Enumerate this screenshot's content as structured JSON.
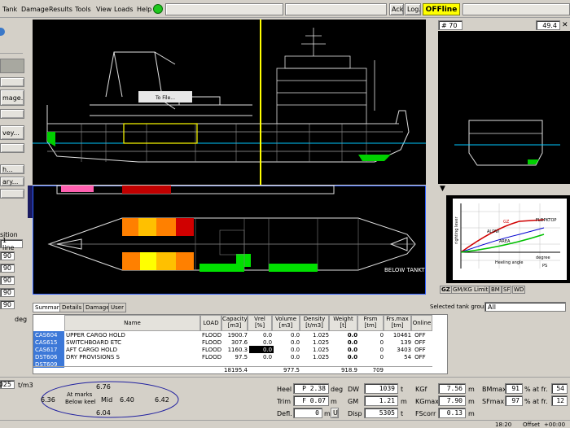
{
  "menu": {
    "tank": "Tank",
    "damage": "Damage",
    "results": "Results",
    "tools": "Tools",
    "view": "View",
    "loads": "Loads",
    "help": "Help"
  },
  "toolbar": {
    "ack": "Ack.",
    "log": "Log...",
    "status": "OFFline"
  },
  "left_buttons": {
    "damage": "mage...",
    "survey": "vey...",
    "btn1": "h...",
    "btn2": "ary...",
    "position": "sition",
    "line_select": "1 line",
    "deg": "deg",
    "v1": "90",
    "v2": "90",
    "v3": "90",
    "v4": "90",
    "v5": "90"
  },
  "profile": {
    "to_file": "To File...",
    "below_tank": "BELOW TANKT"
  },
  "section": {
    "frame": "# 70",
    "value": "49.4"
  },
  "gz_chart": {
    "ylabel": "righting lever",
    "xlabel": "Heeling angle",
    "unit_label": "degree",
    "flooding": "FLDPKTOP",
    "gz": "GZ",
    "aldw": "ALDW",
    "area": "AREA",
    "ps": "PS"
  },
  "right_tabs": {
    "gz": "GZ",
    "gmkg": "GM/KG Limit",
    "bm": "BM",
    "sf": "SF",
    "wd": "WD"
  },
  "tank_group": {
    "label": "Selected tank group:",
    "value": "All"
  },
  "bottom_tabs": {
    "summary": "Summary",
    "details": "Details",
    "damage": "Damage",
    "user": "User"
  },
  "table_headers": {
    "name": "Name",
    "load": "LOAD",
    "capacity": "Capacity",
    "capacity_u": "[m3]",
    "vrel": "Vrel",
    "vrel_u": "[%]",
    "volume": "Volume",
    "volume_u": "[m3]",
    "density": "Density",
    "density_u": "[t/m3]",
    "weight": "Weight",
    "weight_u": "[t]",
    "frsm": "Frsm",
    "frsm_u": "[tm]",
    "frsmax": "Frs.max",
    "frsmax_u": "[tm]",
    "online": "Online"
  },
  "tanks": [
    {
      "id": "CAS604",
      "name": "UPPER CARGO HOLD",
      "load": "FLOOD",
      "cap": "1900.7",
      "vrel": "0.0",
      "vol": "0.0",
      "dens": "1.025",
      "wt": "0.0",
      "frsm": "0",
      "frsmax": "10461",
      "online": "OFF"
    },
    {
      "id": "CAS615",
      "name": "SWITCHBOARD ETC",
      "load": "FLOOD",
      "cap": "307.6",
      "vrel": "0.0",
      "vol": "0.0",
      "dens": "1.025",
      "wt": "0.0",
      "frsm": "0",
      "frsmax": "139",
      "online": "OFF"
    },
    {
      "id": "CAS617",
      "name": "AFT CARGO HOLD",
      "load": "FLOOD",
      "cap": "1160.3",
      "vrel": "0.0",
      "vol": "0.0",
      "dens": "1.025",
      "wt": "0.0",
      "frsm": "0",
      "frsmax": "3403",
      "online": "OFF"
    },
    {
      "id": "DST606",
      "name": "DRY PROVISIONS S",
      "load": "FLOOD",
      "cap": "97.5",
      "vrel": "0.0",
      "vol": "0.0",
      "dens": "1.025",
      "wt": "0.0",
      "frsm": "0",
      "frsmax": "54",
      "online": "OFF"
    },
    {
      "id": "DST609",
      "name": "",
      "load": "",
      "cap": "",
      "vrel": "",
      "vol": "",
      "dens": "",
      "wt": "",
      "frsm": "",
      "frsmax": "",
      "online": ""
    }
  ],
  "totals": {
    "cap": "18195.4",
    "vol": "977.5",
    "wt": "918.9",
    "frsm": "709"
  },
  "density_field": {
    "value": "025",
    "unit": "t/m3"
  },
  "drafts": {
    "fwd": "6.76",
    "aft": "6.04",
    "port": "6.36",
    "stbd": "6.42",
    "mid_label": "Mid",
    "mid": "6.40",
    "at_marks": "At marks",
    "below_keel": "Below keel"
  },
  "results": {
    "heel_label": "Heel",
    "heel": "P 2.38",
    "heel_u": "deg",
    "trim_label": "Trim",
    "trim": "F 0.07",
    "trim_u": "m",
    "defl_label": "Defl.",
    "defl": "0",
    "defl_u": "m",
    "dw_label": "DW",
    "dw": "1039",
    "dw_u": "t",
    "gm_label": "GM",
    "gm": "1.21",
    "gm_u": "m",
    "disp_label": "Disp",
    "disp": "5305",
    "disp_u": "t",
    "kgf_label": "KGf",
    "kgf": "7.56",
    "kgf_u": "m",
    "kgmax_label": "KGmax",
    "kgmax": "7.90",
    "kgmax_u": "m",
    "fscorr_label": "FScorr",
    "fscorr": "0.13",
    "fscorr_u": "m",
    "bmmax_label": "BMmax",
    "bmmax": "91",
    "bmmax_fr": "54",
    "sfmax_label": "SFmax",
    "sfmax": "97",
    "sfmax_fr": "12",
    "pct": "%",
    "at_fr": "at fr."
  },
  "statusbar": {
    "time": "18:20",
    "offset_label": "Offset",
    "offset": "+00:00"
  }
}
